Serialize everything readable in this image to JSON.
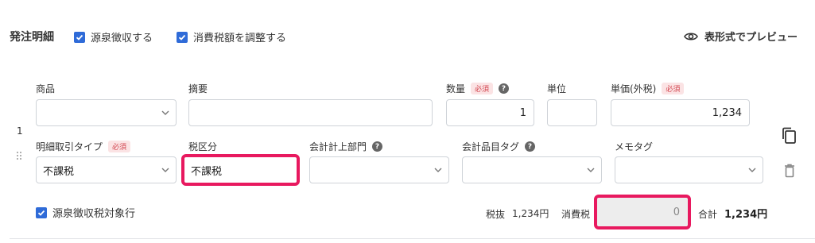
{
  "header": {
    "title": "発注明細",
    "withholding_label": "源泉徴収する",
    "adjust_tax_label": "消費税額を調整する",
    "preview_label": "表形式でプレビュー"
  },
  "row": {
    "index": "1",
    "fields": {
      "product": {
        "label": "商品",
        "value": ""
      },
      "summary": {
        "label": "摘要",
        "value": ""
      },
      "quantity": {
        "label": "数量",
        "required": "必須",
        "value": "1"
      },
      "unit": {
        "label": "単位",
        "value": ""
      },
      "unit_price": {
        "label": "単価(外税)",
        "required": "必須",
        "value": "1,234"
      },
      "transaction_type": {
        "label": "明細取引タイプ",
        "required": "必須",
        "value": "不課税"
      },
      "tax_category": {
        "label": "税区分",
        "value": "不課税"
      },
      "department": {
        "label": "会計計上部門",
        "value": ""
      },
      "account_item_tag": {
        "label": "会計品目タグ",
        "value": ""
      },
      "memo_tag": {
        "label": "メモタグ",
        "value": ""
      }
    },
    "withholding_target_label": "源泉徴収税対象行",
    "summary": {
      "pretax_label": "税抜",
      "pretax_value": "1,234円",
      "tax_label": "消費税",
      "tax_value": "0",
      "total_label": "合計",
      "total_value": "1,234円"
    }
  },
  "colors": {
    "accent": "#2f6bd8",
    "highlight": "#e8195f",
    "required_bg": "#fbe3e4",
    "required_text": "#d2454f"
  },
  "icons": [
    "eye-icon",
    "help-icon",
    "chevron-down-icon",
    "copy-icon",
    "trash-icon",
    "drag-handle-icon",
    "checkbox-checked-icon"
  ]
}
